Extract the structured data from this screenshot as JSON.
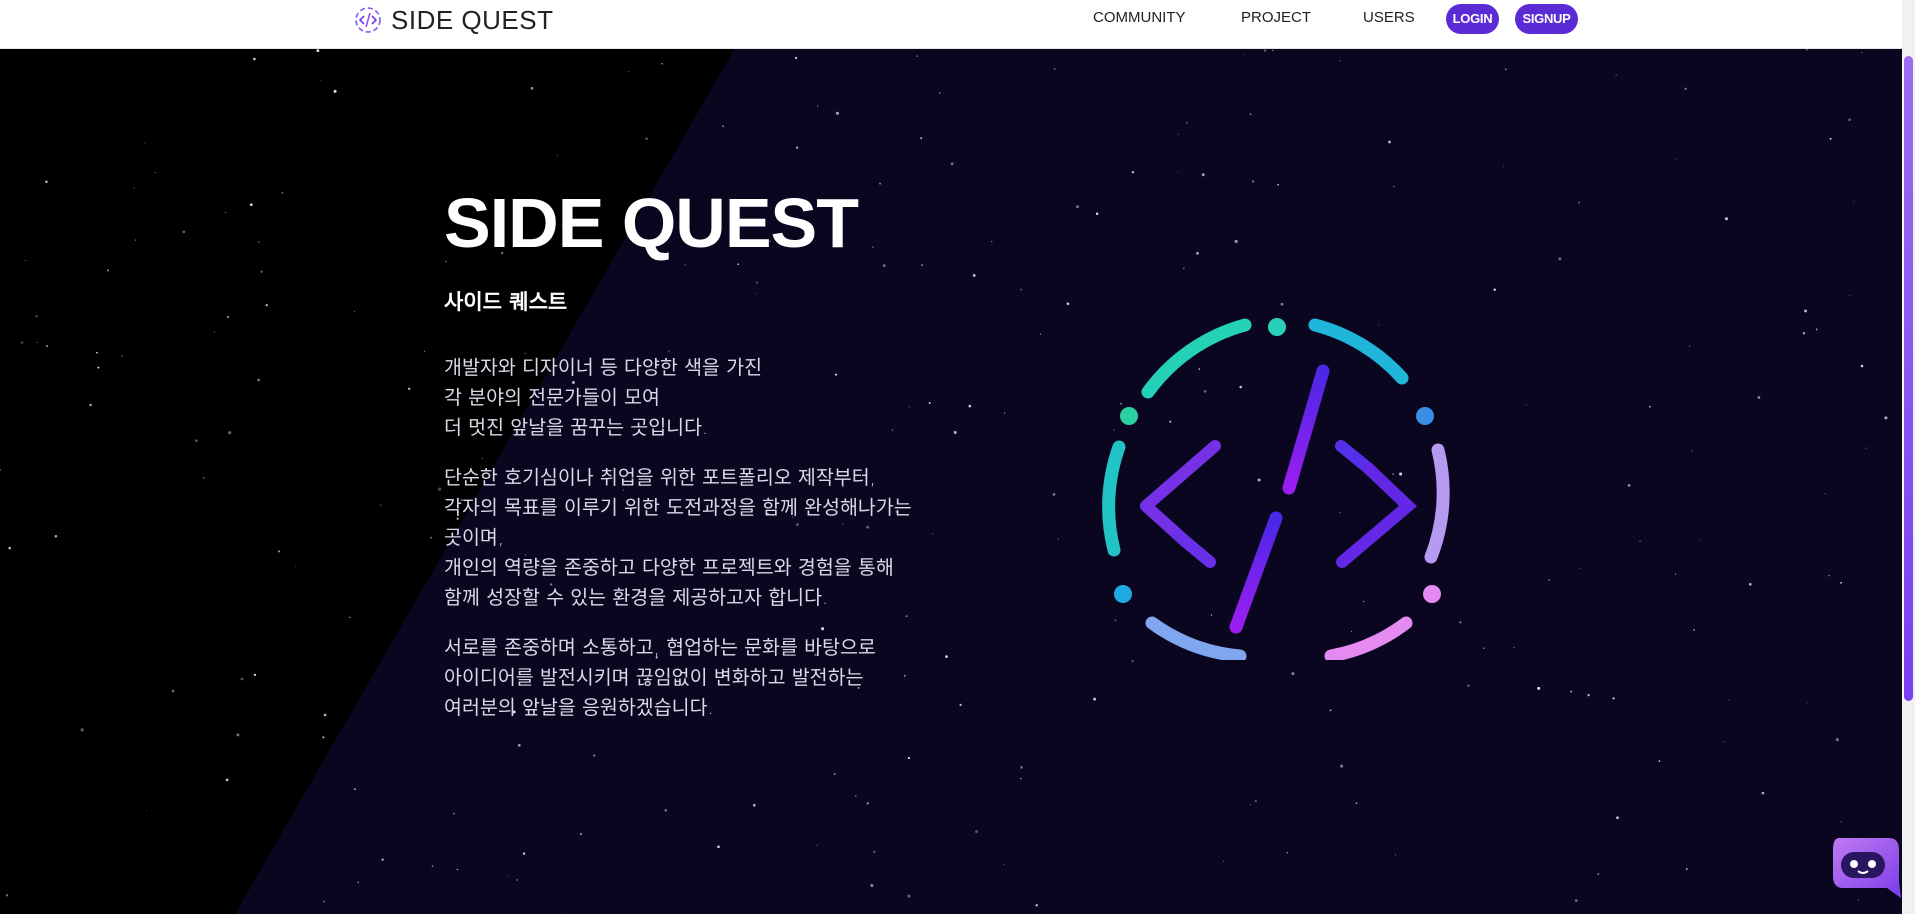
{
  "header": {
    "logo_text": "SIDE QUEST",
    "nav": {
      "community": "COMMUNITY",
      "project": "PROJECT",
      "users": "USERS"
    },
    "login_label": "LOGIN",
    "signup_label": "SIGNUP"
  },
  "hero": {
    "title": "SIDE QUEST",
    "subtitle": "사이드 퀘스트",
    "paragraph1": [
      "개발자와 디자이너 등 다양한 색을 가진",
      "각 분야의 전문가들이 모여",
      "더 멋진 앞날을 꿈꾸는 곳입니다."
    ],
    "paragraph2": [
      "단순한 호기심이나 취업을 위한 포트폴리오 제작부터,",
      "각자의 목표를 이루기 위한 도전과정을 함께 완성해나가는",
      "곳이며,",
      "개인의 역량을 존중하고 다양한 프로젝트와 경험을 통해",
      "함께 성장할 수 있는 환경을 제공하고자 합니다."
    ],
    "paragraph3": [
      "서로를 존중하며 소통하고, 협업하는 문화를 바탕으로",
      "아이디어를 발전시키며 끊임없이 변화하고 발전하는",
      "여러분의 앞날을 응원하겠습니다."
    ]
  },
  "icons": {
    "logo": "code-slash-logo-icon",
    "emblem": "code-brackets-emblem-icon",
    "chat": "chatbot-icon"
  },
  "colors": {
    "accent": "#5b2bd6",
    "background_dark": "#07041a",
    "teal": "#1fd3b8",
    "blue": "#2e9bdc",
    "purple": "#7a2cf0",
    "pink": "#e48af2"
  }
}
